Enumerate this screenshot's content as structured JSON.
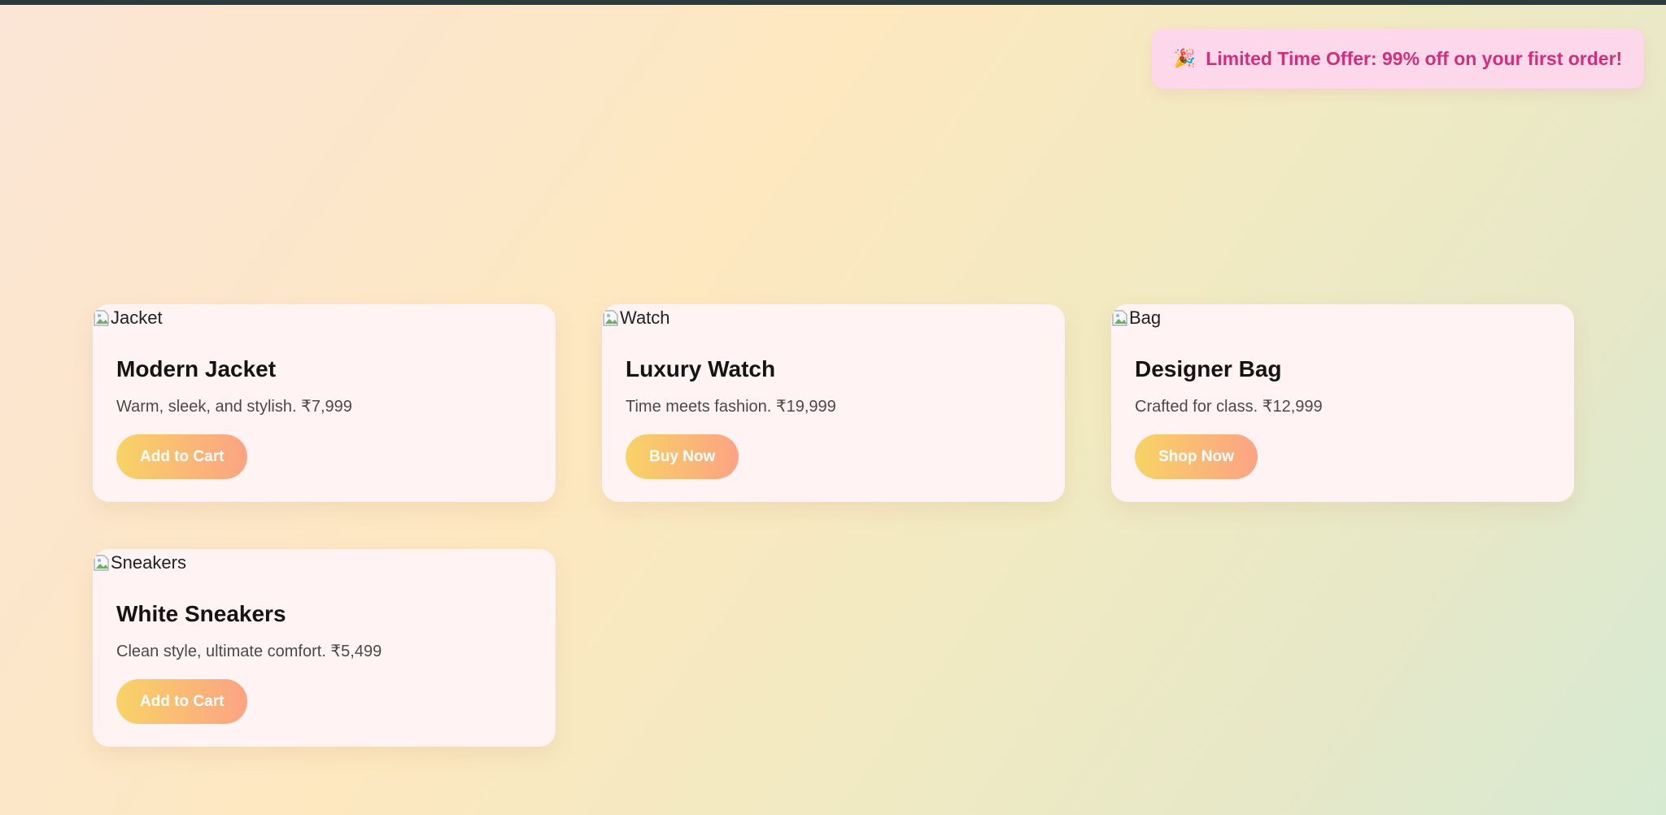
{
  "banner": {
    "icon": "party-popper-icon",
    "emoji": "🎉",
    "text": "Limited Time Offer: 99% off on your first order!"
  },
  "products": [
    {
      "image_alt": "Jacket",
      "title": "Modern Jacket",
      "description": "Warm, sleek, and stylish. ₹7,999",
      "button_label": "Add to Cart"
    },
    {
      "image_alt": "Watch",
      "title": "Luxury Watch",
      "description": "Time meets fashion. ₹19,999",
      "button_label": "Buy Now"
    },
    {
      "image_alt": "Bag",
      "title": "Designer Bag",
      "description": "Crafted for class. ₹12,999",
      "button_label": "Shop Now"
    },
    {
      "image_alt": "Sneakers",
      "title": "White Sneakers",
      "description": "Clean style, ultimate comfort. ₹5,499",
      "button_label": "Add to Cart"
    }
  ],
  "colors": {
    "banner_text": "#d02f7c",
    "banner_bg": "#fdd7ea",
    "button_gradient_start": "#f8d366",
    "button_gradient_end": "#fca383",
    "card_bg": "#fff3f3"
  }
}
